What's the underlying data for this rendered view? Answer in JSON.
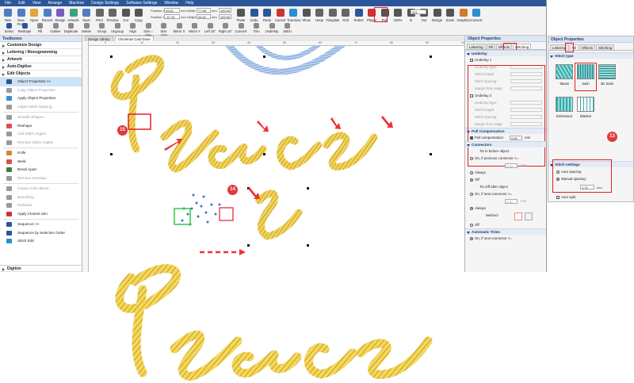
{
  "menubar": [
    "File",
    "Edit",
    "View",
    "Arrange",
    "Machine",
    "Design Settings",
    "Software Settings",
    "Window",
    "Help"
  ],
  "ribbon": {
    "buttons": [
      "New",
      "New From",
      "Open",
      "Recent",
      "Design",
      "Artwork",
      "Save",
      "Print",
      "Preview",
      "Cut",
      "Copy",
      "Paste",
      "Undo",
      "Redo",
      "Cancel",
      "TrueView",
      "Show",
      "Hoop",
      "Template",
      "Grid",
      "Rulers",
      "Player",
      "Pan",
      "100%",
      "In",
      "Out",
      "Design",
      "Zoom",
      "Graphics",
      "Convert"
    ],
    "row2": [
      "Select",
      "Reshape",
      "Fill",
      "Outline",
      "Duplicate",
      "Delete",
      "Group",
      "Ungroup",
      "Align",
      "Size = 15%",
      "Size -15%",
      "Mirror X",
      "Mirror Y",
      "Left 15°",
      "Right 15°",
      "Convert",
      "Trim",
      "Underlay",
      "Stitch"
    ],
    "position_x_label": "Position X:",
    "position_x": "25.61",
    "position_y_label": "Position Y:",
    "position_y": "-37.16",
    "width_label": "Width:",
    "width": "77.98",
    "height_label": "Height:",
    "height": "26.62",
    "unit": "mm",
    "pct1": "100.00",
    "pct2": "100.00",
    "zoom": "201"
  },
  "sidebar": {
    "title": "Toolboxes",
    "categories": [
      "Customize Design",
      "Lettering / Monogramming",
      "Artwork",
      "Auto-Digitize",
      "Edit Objects"
    ],
    "tools": [
      {
        "label": "Object Properties >>",
        "state": "sel"
      },
      {
        "label": "Copy Object Properties",
        "state": "dis"
      },
      {
        "label": "Apply Object Properties",
        "state": ""
      },
      {
        "label": "Adjust Stitch Spacing...",
        "state": "dis"
      },
      {
        "label": "Smooth Shapes...",
        "state": "dis"
      },
      {
        "label": "Reshape",
        "state": ""
      },
      {
        "label": "Add Stitch Angles",
        "state": "dis"
      },
      {
        "label": "Remove Stitch Angles",
        "state": "dis"
      },
      {
        "label": "Knife",
        "state": ""
      },
      {
        "label": "Weld",
        "state": ""
      },
      {
        "label": "Break Apart",
        "state": ""
      },
      {
        "label": "Remove Overlaps",
        "state": "dis"
      },
      {
        "label": "Create Color Blend...",
        "state": "dis"
      },
      {
        "label": "Branching",
        "state": "dis"
      },
      {
        "label": "Redwork",
        "state": "dis"
      },
      {
        "label": "Apply Closest Join",
        "state": ""
      },
      {
        "label": "Sequence >>",
        "state": ""
      },
      {
        "label": "Sequence by Selection Order",
        "state": ""
      },
      {
        "label": "Stitch Edit",
        "state": ""
      }
    ],
    "bottom_category": "Digitize"
  },
  "doctabs": [
    "Design Library",
    "Christmas Card Dove"
  ],
  "ruler_marks": [
    "0",
    "10",
    "20",
    "30",
    "40",
    "50",
    "60",
    "70",
    "80",
    "90",
    "100"
  ],
  "props": {
    "title": "Object Properties",
    "tabs": [
      "Lettering",
      "Fill",
      "Effects",
      "Stitching"
    ],
    "underlay_title": "Underlay",
    "underlay1": "Underlay 1",
    "underlay_rows1": [
      "Underlay type:",
      "Stitch length:",
      "Stitch spacing:",
      "Margin from edge:"
    ],
    "underlay2": "Underlay 2",
    "underlay_rows2": [
      "Underlay type:",
      "Stitch length:",
      "Stitch spacing:",
      "Margin from edge:"
    ],
    "pull_title": "Pull Compensation",
    "pull_label": "Pull compensation:",
    "pull_value": "0.80",
    "unit": "mm",
    "connectors_title": "Connectors",
    "tie_in": "Tie in before object",
    "tie_in_opt1": "On, if previous connector >=",
    "tie_in_val": "2.00",
    "always": "Always",
    "off": "Off",
    "tie_off": "Tie Off after object",
    "tie_off_opt1": "On, if next connector >=",
    "tie_off_val": "2.00",
    "always2": "Always",
    "method": "Method:",
    "off2": "Off",
    "trims_title": "Automatic Trims",
    "trims_opt1": "On, if next connector >="
  },
  "props2": {
    "title": "Object Properties",
    "tabs": [
      "Lettering",
      "Fill",
      "Effects",
      "Stitching"
    ],
    "stitch_type_title": "Stitch type",
    "types": [
      "Tatami",
      "Satin",
      "3D Satin",
      "Embossed",
      "Blanket"
    ],
    "stitch_settings_title": "Stitch settings",
    "auto_spacing": "Auto spacing",
    "manual_spacing": "Manual spacing:",
    "manual_value": "1.70",
    "unit": "mm",
    "auto_split": "Auto split"
  },
  "badges": [
    "15",
    "14",
    "13"
  ],
  "colors": {
    "thread": "#e8c53a",
    "thread_dark": "#9c7a12",
    "ribbon_blue": "#2b579a",
    "highlight_red": "#e21f26",
    "selection_green": "#2ecc40",
    "blue_arc": "#7aa4d6"
  }
}
